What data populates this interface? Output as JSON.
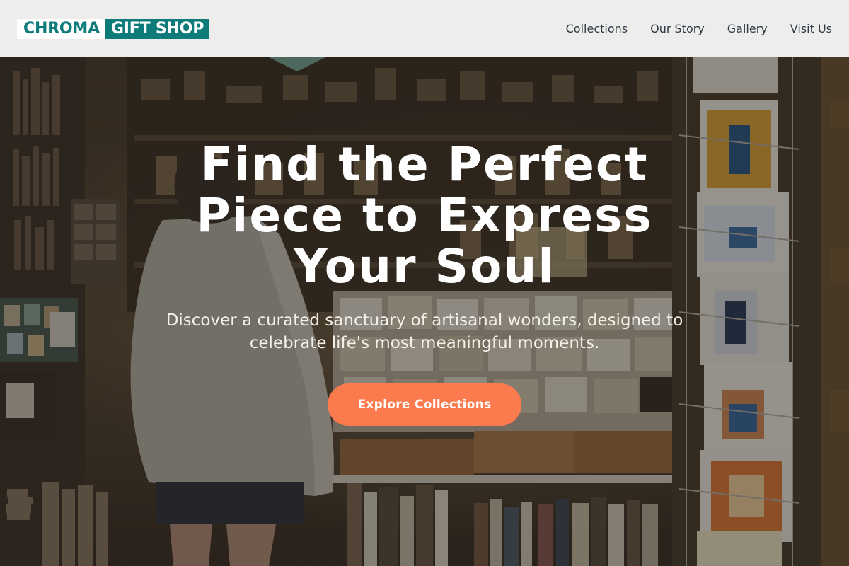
{
  "brand": {
    "part1": "CHROMA",
    "part2": "GIFT SHOP",
    "accent_color": "#0e7b7b"
  },
  "nav": {
    "items": [
      {
        "label": "Collections"
      },
      {
        "label": "Our Story"
      },
      {
        "label": "Gallery"
      },
      {
        "label": "Visit Us"
      }
    ]
  },
  "hero": {
    "title_line1": "Find the Perfect",
    "title_line2": "Piece to Express",
    "title_line3": "Your Soul",
    "subtitle_line1": "Discover a curated sanctuary of artisanal wonders, designed to",
    "subtitle_line2": "celebrate life's most meaningful moments.",
    "cta_label": "Explore Collections",
    "cta_color": "#fb7a4e",
    "background_image": "gift shop interior photo"
  }
}
